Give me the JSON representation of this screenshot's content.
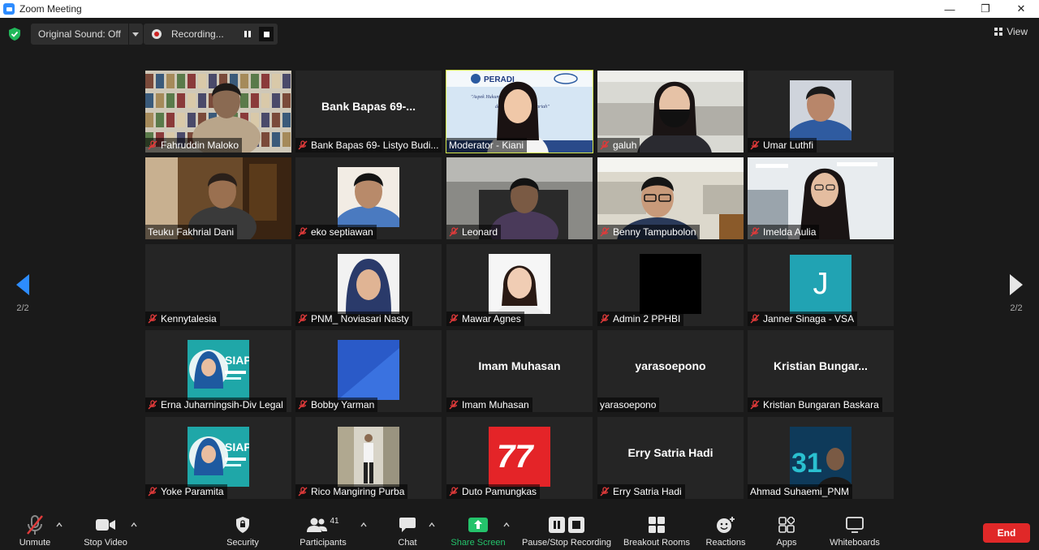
{
  "window": {
    "title": "Zoom Meeting",
    "minimize": "—",
    "restore": "❐",
    "close": "✕"
  },
  "topbar": {
    "original_sound": "Original Sound: Off",
    "recording": "Recording...",
    "view": "View"
  },
  "pager": {
    "left": "2/2",
    "right": "2/2"
  },
  "participants": [
    {
      "name": "Fahruddin Maloko",
      "muted": true,
      "video": "bookshelf-man"
    },
    {
      "name": "Bank Bapas 69- Listyo Budi...",
      "big": "Bank Bapas 69-...",
      "muted": true,
      "video": "none"
    },
    {
      "name": "Moderator - Kiani",
      "muted": false,
      "speaker": true,
      "video": "moderator",
      "banner_text": "PERADI",
      "banner_sub": "\"Aspek Hukum Pe... Perbankan dan Penyelesaian ...yariah\""
    },
    {
      "name": "galuh",
      "muted": true,
      "video": "office-woman-mask"
    },
    {
      "name": "Umar Luthfi",
      "muted": true,
      "video": "center-photo-man"
    },
    {
      "name": "Teuku Fakhrial Dani",
      "muted": false,
      "video": "dark-room-man"
    },
    {
      "name": "eko septiawan",
      "muted": true,
      "video": "center-photo-man2"
    },
    {
      "name": "Leonard",
      "muted": true,
      "video": "car-man"
    },
    {
      "name": "Benny Tampubolon",
      "muted": true,
      "video": "office-man-glasses"
    },
    {
      "name": "Imelda Aulia",
      "muted": true,
      "video": "office-woman"
    },
    {
      "name": "Kennytalesia",
      "muted": true,
      "video": "none"
    },
    {
      "name": "PNM_ Noviasari Nasty",
      "muted": true,
      "video": "hijab-photo"
    },
    {
      "name": "Mawar Agnes",
      "muted": true,
      "video": "woman-photo"
    },
    {
      "name": "Admin 2 PPHBI",
      "muted": true,
      "video": "black"
    },
    {
      "name": "Janner Sinaga - VSA",
      "muted": true,
      "video": "avatar-j",
      "initial": "J"
    },
    {
      "name": "Erna Juharningsih-Div Legal",
      "muted": true,
      "video": "siap-poster",
      "poster_text": "SIAP"
    },
    {
      "name": "Bobby Yarman",
      "muted": true,
      "video": "blue-square"
    },
    {
      "name": "Imam Muhasan",
      "big": "Imam Muhasan",
      "muted": true,
      "video": "none"
    },
    {
      "name": "yarasoepono",
      "big": "yarasoepono",
      "muted": false,
      "video": "none"
    },
    {
      "name": "Kristian Bungaran Baskara",
      "big": "Kristian Bungar...",
      "muted": true,
      "video": "none"
    },
    {
      "name": "Yoke Paramita",
      "muted": true,
      "video": "siap-poster",
      "poster_text": "SIAP"
    },
    {
      "name": "Rico Mangiring Purba",
      "muted": true,
      "video": "standing-man"
    },
    {
      "name": "Duto Pamungkas",
      "muted": true,
      "video": "red-77",
      "poster_text": "77"
    },
    {
      "name": "Erry Satria Hadi",
      "big": "Erry Satria Hadi",
      "muted": true,
      "video": "none"
    },
    {
      "name": "Ahmad Suhaemi_PNM",
      "muted": false,
      "video": "poster-31",
      "poster_text": "31"
    }
  ],
  "toolbar": {
    "unmute": "Unmute",
    "stop_video": "Stop Video",
    "security": "Security",
    "participants": "Participants",
    "participants_count": "41",
    "chat": "Chat",
    "share_screen": "Share Screen",
    "pause_stop": "Pause/Stop Recording",
    "breakout": "Breakout Rooms",
    "reactions": "Reactions",
    "apps": "Apps",
    "whiteboards": "Whiteboards",
    "end": "End"
  },
  "colors": {
    "accent": "#2d8cff",
    "speaker_outline": "#d4e74a",
    "share_green": "#24c36b",
    "end_red": "#e02828",
    "mute_red": "#e03a3a"
  }
}
